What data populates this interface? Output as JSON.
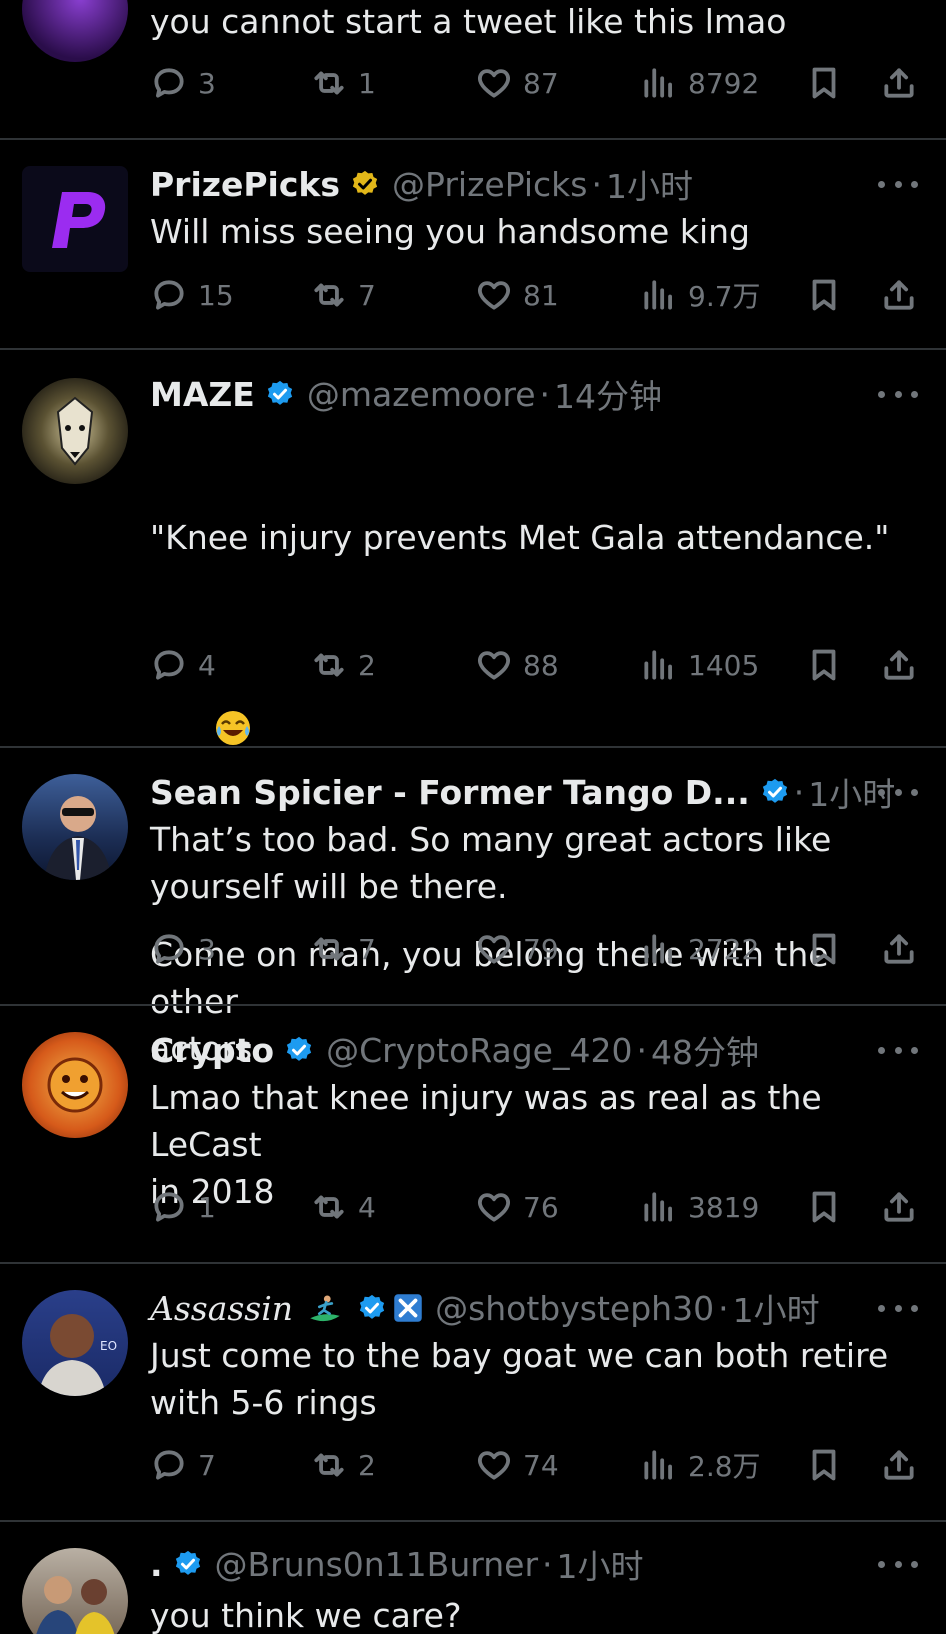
{
  "tweets": [
    {
      "body": "you cannot start a tweet like this lmao",
      "replies": "3",
      "retweets": "1",
      "likes": "87",
      "views": "8792"
    },
    {
      "name": "PrizePicks",
      "handle": "@PrizePicks",
      "time": "1小时",
      "body": "Will miss seeing you handsome king",
      "replies": "15",
      "retweets": "7",
      "likes": "81",
      "views": "9.7万"
    },
    {
      "name": "MAZE",
      "handle": "@mazemoore",
      "time": "14分钟",
      "body_line1": "\"Knee injury prevents Met Gala attendance.\"",
      "body_line2": "Come on man, you belong there with the other\nactors.",
      "replies": "4",
      "retweets": "2",
      "likes": "88",
      "views": "1405"
    },
    {
      "name": "Sean Spicier - Former Tango D...",
      "handle": "",
      "time": "1小时",
      "body": "That’s too bad. So many great actors like\nyourself will be there.",
      "replies": "3",
      "retweets": "7",
      "likes": "79",
      "views": "2722"
    },
    {
      "name": "Crypto",
      "handle": "@CryptoRage_420",
      "time": "48分钟",
      "body": "Lmao that knee injury was as real as the LeCast\nin 2018",
      "replies": "1",
      "retweets": "4",
      "likes": "76",
      "views": "3819"
    },
    {
      "name": "Assassin",
      "handle": "@shotbysteph30",
      "time": "1小时",
      "body": "Just come to the bay goat we can both retire\nwith 5-6 rings",
      "replies": "7",
      "retweets": "2",
      "likes": "74",
      "views": "2.8万"
    },
    {
      "name": ".",
      "handle": "@Bruns0n11Burner",
      "time": "1小时",
      "body": "you think we care?"
    }
  ],
  "separator": "·",
  "colors": {
    "background": "#000000",
    "text": "#e7e9ea",
    "muted": "#71767b",
    "verified": "#1d9bf0",
    "gold": "#e2b719"
  }
}
